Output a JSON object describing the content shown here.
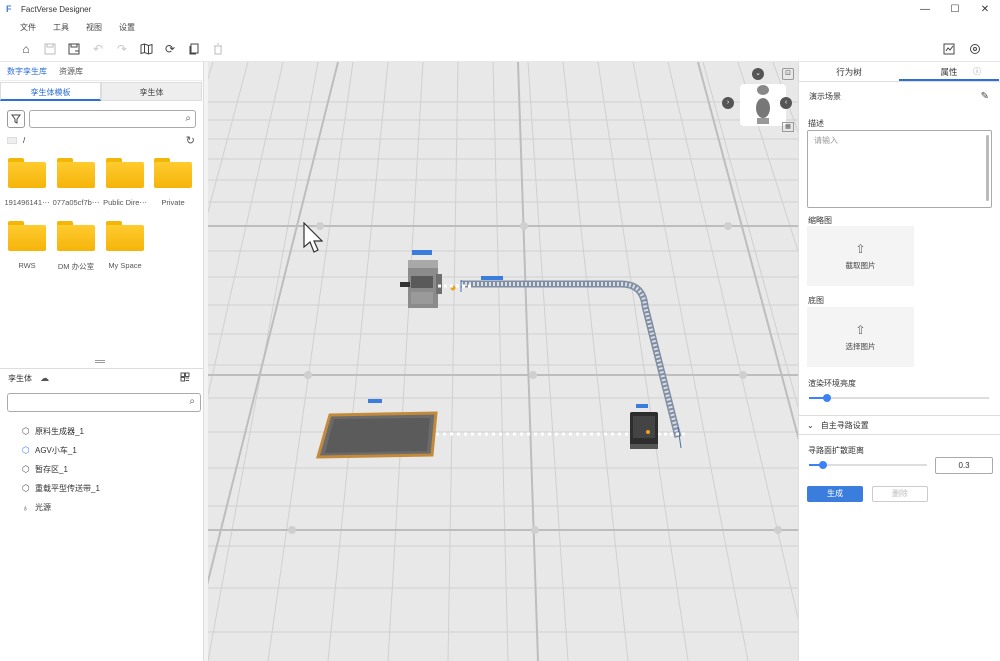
{
  "window": {
    "title": "FactVerse Designer",
    "logo": "F"
  },
  "window_controls": {
    "minimize": "—",
    "maximize": "☐",
    "close": "✕"
  },
  "menu": [
    "文件",
    "工具",
    "视图",
    "设置"
  ],
  "toolbar": {
    "icons": [
      "home-icon",
      "save-icon",
      "save-as-icon",
      "undo-icon",
      "redo-icon",
      "map-icon",
      "sync-icon",
      "copy-icon",
      "delete-icon"
    ],
    "right_icons": [
      "chart-icon",
      "settings-icon"
    ]
  },
  "left_panel": {
    "tabs": [
      "数字孪生库",
      "资源库"
    ],
    "sub_tabs": [
      "孪生体模板",
      "孪生体"
    ],
    "path": "/",
    "folders": [
      "191496141⋯",
      "077a05cf7b⋯",
      "Public Dire⋯",
      "Private",
      "RWS",
      "DM 办公室",
      "My Space"
    ],
    "twin_section_label": "孪生体",
    "twins": [
      {
        "label": "原料生成器_1",
        "icon": "cube-icon"
      },
      {
        "label": "AGV小车_1",
        "icon": "agv-cube-icon"
      },
      {
        "label": "暂存区_1",
        "icon": "cube-icon"
      },
      {
        "label": "重载平型传送带_1",
        "icon": "cube-icon"
      },
      {
        "label": "光源",
        "icon": "light-bulb-icon"
      }
    ]
  },
  "right_panel": {
    "tabs": [
      "行为树",
      "属性"
    ],
    "scene_label": "演示场景",
    "description_label": "描述",
    "description_placeholder": "请输入",
    "thumbnail_label": "缩略图",
    "thumbnail_button": "截取图片",
    "floor_label": "底图",
    "floor_button": "选择图片",
    "env_brightness_label": "渲染环境亮度",
    "env_brightness_value": 0.1,
    "pathfinding_section": "自主寻路设置",
    "expand_distance_label": "寻路面扩散距离",
    "expand_distance_value": "0.3",
    "generate_button": "生成",
    "delete_button": "删除"
  },
  "colors": {
    "accent": "#2d6fd6",
    "folder": "#ffc21a",
    "viewport_bg": "#e9e9e9"
  }
}
